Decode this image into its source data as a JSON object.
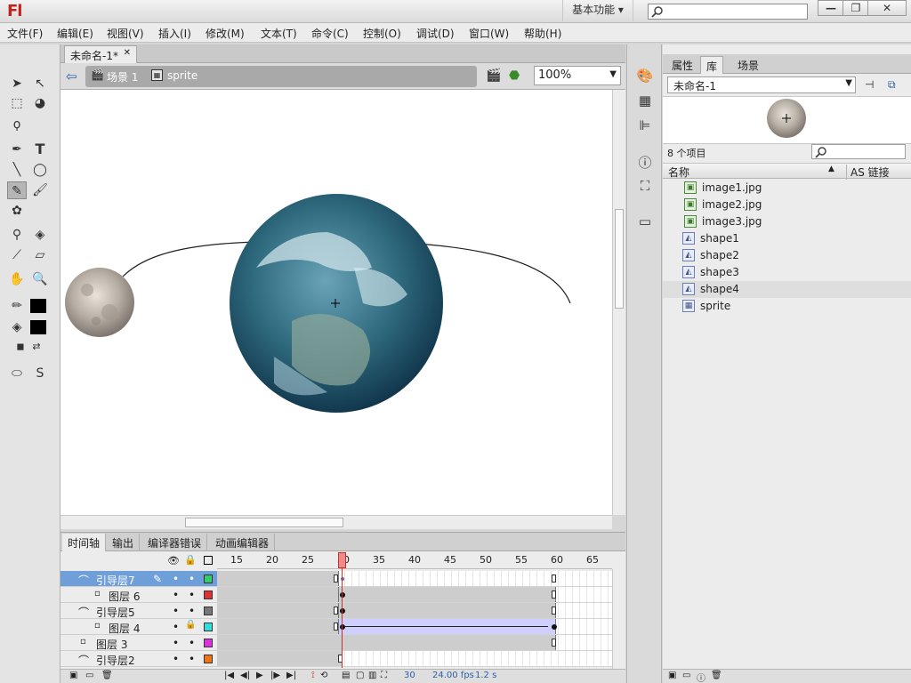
{
  "app": {
    "logo": "Fl",
    "workspace": "基本功能"
  },
  "window_controls": {
    "minimize": "—",
    "maximize": "❐",
    "close": "✕"
  },
  "menu": [
    "文件(F)",
    "编辑(E)",
    "视图(V)",
    "插入(I)",
    "修改(M)",
    "文本(T)",
    "命令(C)",
    "控制(O)",
    "调试(D)",
    "窗口(W)",
    "帮助(H)"
  ],
  "document": {
    "tab_title": "未命名-1*",
    "scene": "场景 1",
    "symbol": "sprite",
    "zoom": "100%"
  },
  "timeline": {
    "tabs": [
      "时间轴",
      "输出",
      "编译器错误",
      "动画编辑器"
    ],
    "ruler": [
      "15",
      "20",
      "25",
      "30",
      "35",
      "40",
      "45",
      "50",
      "55",
      "60",
      "65"
    ],
    "layers": [
      {
        "name": "引导层7",
        "color": "#33cc66",
        "selected": true,
        "locked": false
      },
      {
        "name": "图层 6",
        "color": "#dd3333",
        "selected": false,
        "locked": false
      },
      {
        "name": "引导层5",
        "color": "#777777",
        "selected": false,
        "locked": false
      },
      {
        "name": "图层 4",
        "color": "#33dddd",
        "selected": false,
        "locked": true
      },
      {
        "name": "图层 3",
        "color": "#dd33dd",
        "selected": false,
        "locked": false
      },
      {
        "name": "引导层2",
        "color": "#ee7711",
        "selected": false,
        "locked": false
      }
    ],
    "status": {
      "frame": "30",
      "fps": "24.00 fps",
      "time": "1.2 s"
    }
  },
  "library": {
    "tabs": [
      "属性",
      "库",
      "场景"
    ],
    "document": "未命名-1",
    "count": "8 个项目",
    "col_name": "名称",
    "col_link": "AS 链接",
    "items": [
      {
        "name": "image1.jpg",
        "type": "bitmap",
        "indent": true
      },
      {
        "name": "image2.jpg",
        "type": "bitmap",
        "indent": true
      },
      {
        "name": "image3.jpg",
        "type": "bitmap",
        "indent": true
      },
      {
        "name": "shape1",
        "type": "graphic",
        "indent": false
      },
      {
        "name": "shape2",
        "type": "graphic",
        "indent": false
      },
      {
        "name": "shape3",
        "type": "graphic",
        "indent": false
      },
      {
        "name": "shape4",
        "type": "graphic",
        "indent": false,
        "selected": true
      },
      {
        "name": "sprite",
        "type": "movieclip",
        "indent": false
      }
    ]
  }
}
